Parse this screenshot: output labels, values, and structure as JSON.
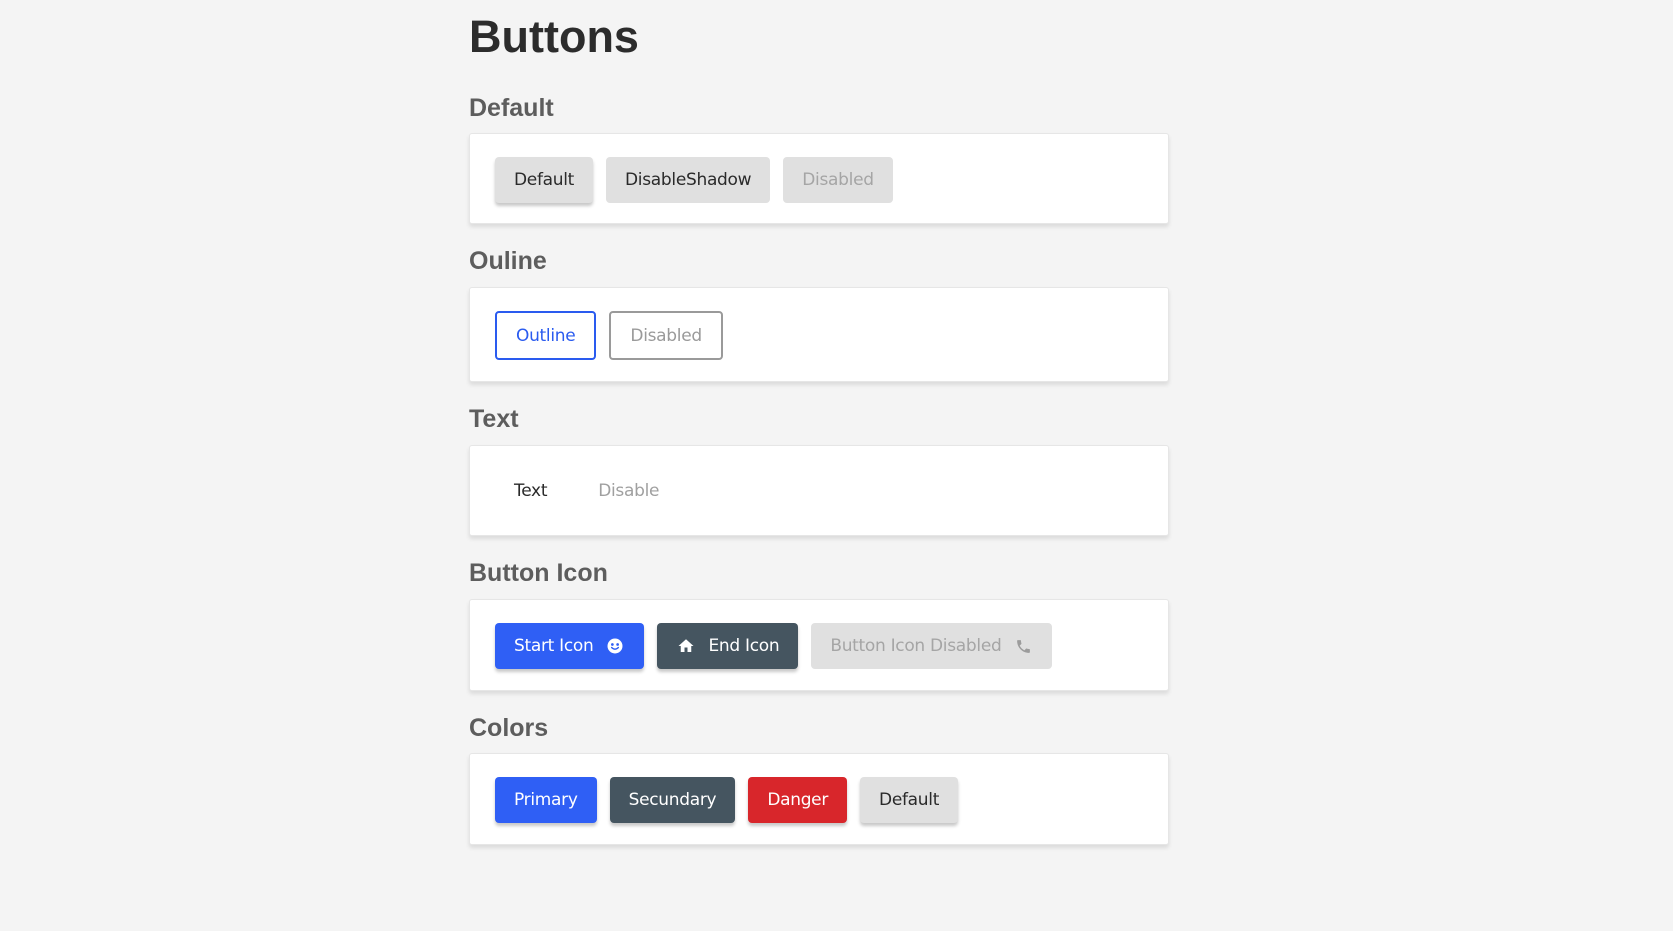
{
  "page": {
    "title": "Buttons"
  },
  "sections": {
    "default": {
      "title": "Default",
      "buttons": {
        "default": "Default",
        "disable_shadow": "DisableShadow",
        "disabled": "Disabled"
      }
    },
    "outline": {
      "title": "Ouline",
      "buttons": {
        "outline": "Outline",
        "disabled": "Disabled"
      }
    },
    "text": {
      "title": "Text",
      "buttons": {
        "text": "Text",
        "disabled": "Disable"
      }
    },
    "button_icon": {
      "title": "Button Icon",
      "buttons": {
        "start_icon": "Start Icon",
        "end_icon": "End Icon",
        "disabled": "Button Icon Disabled"
      },
      "icons": {
        "start_icon": "smiley-face-icon",
        "end_icon": "home-icon",
        "disabled": "phone-icon"
      }
    },
    "colors": {
      "title": "Colors",
      "buttons": {
        "primary": "Primary",
        "secondary": "Secundary",
        "danger": "Danger",
        "default": "Default"
      }
    }
  },
  "colors": {
    "primary": "#2f5ff5",
    "secondary": "#455560",
    "danger": "#d8262b",
    "default": "#e0e0e0",
    "outline": "#2a5bef",
    "background": "#f4f4f4"
  }
}
